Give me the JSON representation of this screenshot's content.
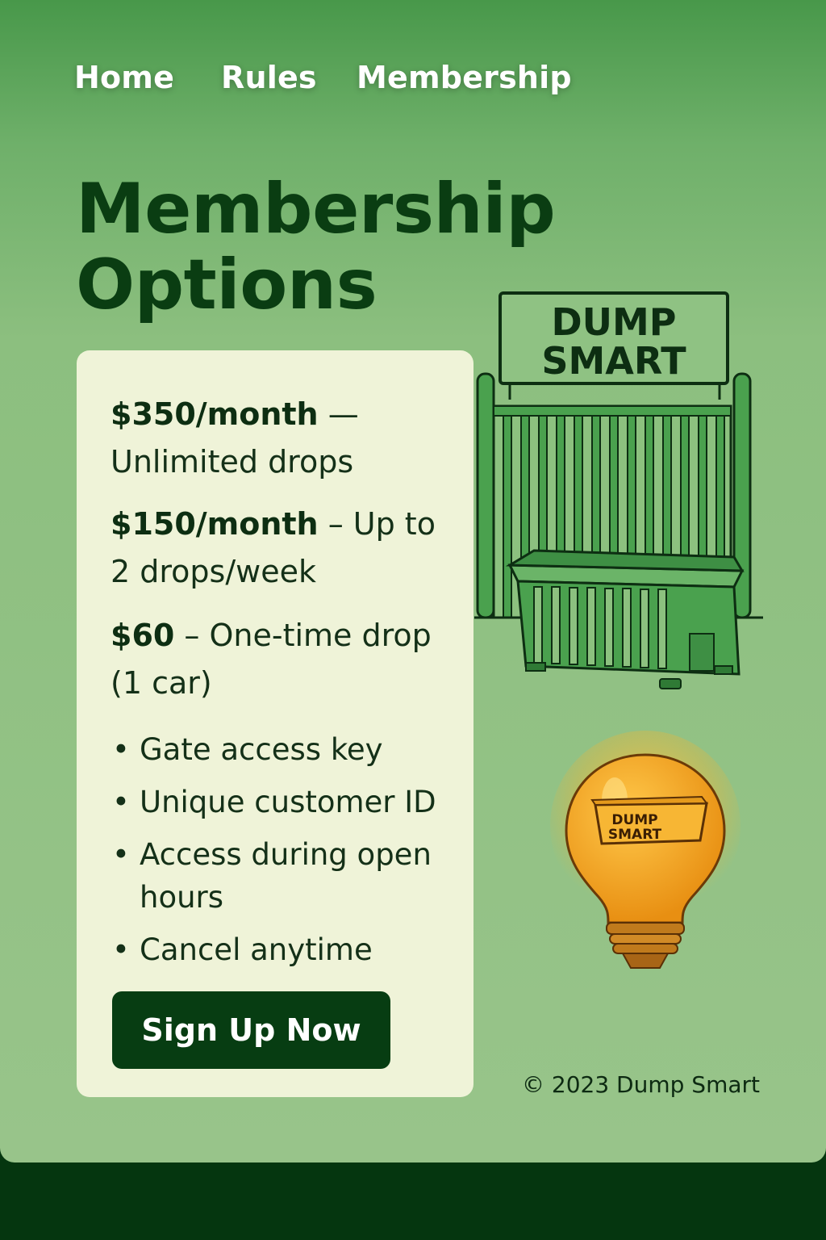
{
  "nav": {
    "links": [
      "Home",
      "Rules",
      "Membership"
    ]
  },
  "title": {
    "line1": "Membership",
    "line2": "Options"
  },
  "plans": [
    {
      "price": "$350/month",
      "description": " — Unlimited drops"
    },
    {
      "price": "$150/month",
      "description": " – Up to 2 drops/week"
    },
    {
      "price": "$60",
      "description": " – One-time drop (1 car)"
    }
  ],
  "features": [
    "Gate access key",
    "Unique customer ID",
    "Access during open hours",
    "Cancel anytime"
  ],
  "bullet": "•",
  "cta": {
    "label": "Sign Up Now"
  },
  "illustration": {
    "sign_line1": "DUMP",
    "sign_line2": "SMART",
    "icon": "gate-dumpster-icon"
  },
  "bulb": {
    "label_line1": "DUMP",
    "label_line2": "SMART",
    "icon": "lightbulb-icon"
  },
  "footer": {
    "copyright": "© 2023 Dump Smart"
  },
  "colors": {
    "header_green": "#48984a",
    "background_green": "#98c48a",
    "dark_green": "#073d12",
    "card_cream": "#eff3d8",
    "bulb_orange": "#f0a020"
  }
}
